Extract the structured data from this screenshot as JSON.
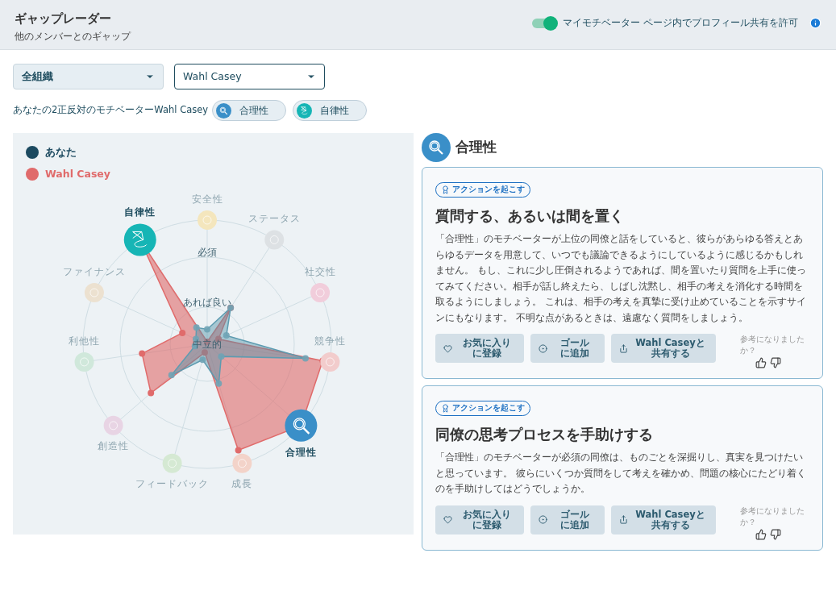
{
  "header": {
    "title": "ギャップレーダー",
    "subtitle": "他のメンバーとのギャップ",
    "share_toggle": {
      "label": "マイモチベーター ページ内でプロフィール共有を許可",
      "on": true
    }
  },
  "filters": [
    {
      "kind": "filled",
      "value": "全組織"
    },
    {
      "kind": "outlined",
      "value": "Wahl Casey"
    }
  ],
  "opposites": {
    "text": "あなたの2正反対のモチベーターWahl Casey",
    "chips": [
      {
        "label": "合理性",
        "kind": "rational",
        "color": "#3a8fc8"
      },
      {
        "label": "自律性",
        "kind": "autonomy",
        "color": "#16b5b5"
      }
    ]
  },
  "radar": {
    "legend": [
      {
        "label": "あなた",
        "color": "#1c4a60"
      },
      {
        "label": "Wahl Casey",
        "color": "#e06b6b"
      }
    ],
    "rings": [
      {
        "label": "必須"
      },
      {
        "label": "あれば良い"
      },
      {
        "label": "中立的"
      }
    ],
    "axes": [
      {
        "label": "安全性",
        "color": "#f4e6bd",
        "highlighted": false
      },
      {
        "label": "ステータス",
        "color": "#dde1e4",
        "highlighted": false
      },
      {
        "label": "社交性",
        "color": "#f1cddb",
        "highlighted": false
      },
      {
        "label": "競争性",
        "color": "#f2cccc",
        "highlighted": false
      },
      {
        "label": "合理性",
        "color": "#3a8fc8",
        "highlighted": true,
        "kind": "rational"
      },
      {
        "label": "成長",
        "color": "#f3d3c9",
        "highlighted": false
      },
      {
        "label": "フィードバック",
        "color": "#d5e9d3",
        "highlighted": false
      },
      {
        "label": "創造性",
        "color": "#e8d4e4",
        "highlighted": false
      },
      {
        "label": "利他性",
        "color": "#d0e8db",
        "highlighted": false
      },
      {
        "label": "ファイナンス",
        "color": "#ece1d0",
        "highlighted": false
      },
      {
        "label": "自律性",
        "color": "#16b5b5",
        "highlighted": true,
        "kind": "autonomy"
      }
    ]
  },
  "detail": {
    "title": "合理性",
    "kind": "rational",
    "cards": [
      {
        "badge": "アクションを起こす",
        "title": "質問する、あるいは間を置く",
        "body": "「合理性」のモチベーターが上位の同僚と話をしていると、彼らがあらゆる答えとあらゆるデータを用意して、いつでも議論できるようにしているように感じるかもしれません。 もし、これに少し圧倒されるようであれば、間を置いたり質問を上手に使ってみてください。相手が話し終えたら、しばし沈黙し、相手の考えを消化する時間を取るようにしましょう。 これは、相手の考えを真摯に受け止めていることを示すサインにもなります。 不明な点があるときは、遠慮なく質問をしましょう。",
        "actions": [
          {
            "kind": "favorite",
            "lines": [
              "お気に入り",
              "に登録"
            ]
          },
          {
            "kind": "goal",
            "lines": [
              "ゴール",
              "に追加"
            ]
          },
          {
            "kind": "share",
            "lines": [
              "Wahl Caseyと",
              "共有する"
            ]
          }
        ],
        "feedback": "参考になりましたか？"
      },
      {
        "badge": "アクションを起こす",
        "title": "同僚の思考プロセスを手助けする",
        "body": "「合理性」のモチベーターが必須の同僚は、ものごとを深掘りし、真実を見つけたいと思っています。 彼らにいくつか質問をして考えを確かめ、問題の核心にたどり着くのを手助けしてはどうでしょうか。",
        "actions": [
          {
            "kind": "favorite",
            "lines": [
              "お気に入り",
              "に登録"
            ]
          },
          {
            "kind": "goal",
            "lines": [
              "ゴール",
              "に追加"
            ]
          },
          {
            "kind": "share",
            "lines": [
              "Wahl Caseyと",
              "共有する"
            ]
          }
        ],
        "feedback": "参考になりましたか？"
      }
    ]
  }
}
